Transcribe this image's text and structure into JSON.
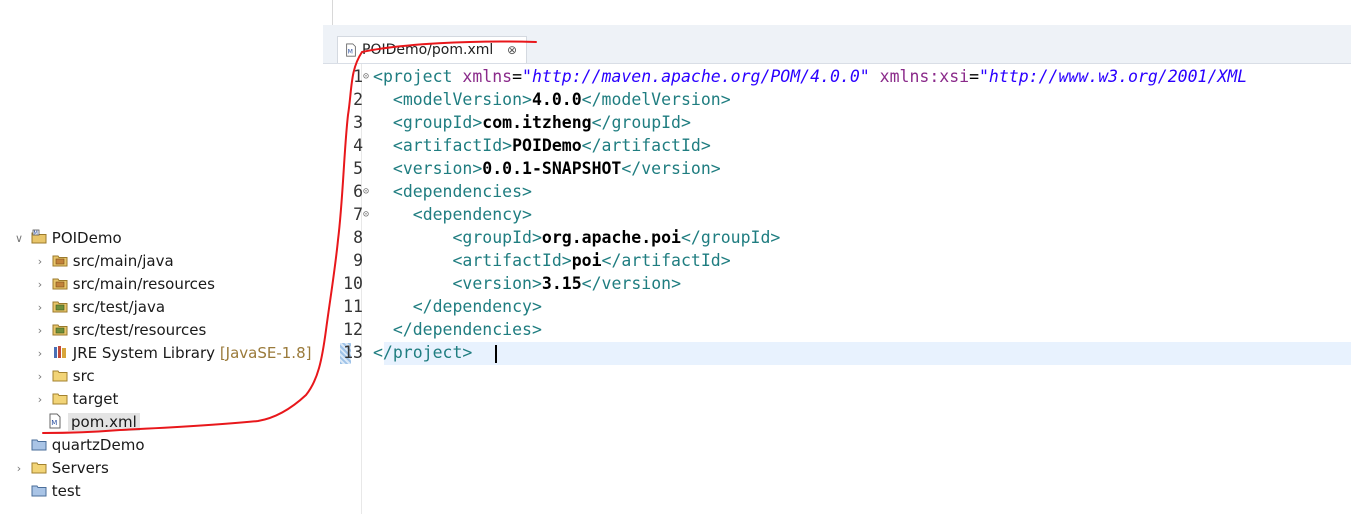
{
  "editor": {
    "tab": {
      "label": "POIDemo/pom.xml",
      "close_glyph": "⊗"
    },
    "lines": [
      {
        "n": "1",
        "fold": "⊝",
        "indent": "",
        "tokens": [
          {
            "t": "bracket",
            "v": "<"
          },
          {
            "t": "tag",
            "v": "project"
          },
          {
            "t": "eq",
            "v": " "
          },
          {
            "t": "attr",
            "v": "xmlns"
          },
          {
            "t": "eq",
            "v": "="
          },
          {
            "t": "str",
            "v": "\"http://maven.apache.org/POM/4.0.0\""
          },
          {
            "t": "eq",
            "v": " "
          },
          {
            "t": "attr",
            "v": "xmlns:xsi"
          },
          {
            "t": "eq",
            "v": "="
          },
          {
            "t": "str",
            "v": "\"http://www.w3.org/2001/XML"
          }
        ]
      },
      {
        "n": "2",
        "fold": "",
        "indent": "  ",
        "tokens": [
          {
            "t": "bracket",
            "v": "<"
          },
          {
            "t": "tag",
            "v": "modelVersion"
          },
          {
            "t": "bracket",
            "v": ">"
          },
          {
            "t": "text",
            "v": "4.0.0"
          },
          {
            "t": "bracket",
            "v": "</"
          },
          {
            "t": "tag",
            "v": "modelVersion"
          },
          {
            "t": "bracket",
            "v": ">"
          }
        ]
      },
      {
        "n": "3",
        "fold": "",
        "indent": "  ",
        "tokens": [
          {
            "t": "bracket",
            "v": "<"
          },
          {
            "t": "tag",
            "v": "groupId"
          },
          {
            "t": "bracket",
            "v": ">"
          },
          {
            "t": "text",
            "v": "com.itzheng"
          },
          {
            "t": "bracket",
            "v": "</"
          },
          {
            "t": "tag",
            "v": "groupId"
          },
          {
            "t": "bracket",
            "v": ">"
          }
        ]
      },
      {
        "n": "4",
        "fold": "",
        "indent": "  ",
        "tokens": [
          {
            "t": "bracket",
            "v": "<"
          },
          {
            "t": "tag",
            "v": "artifactId"
          },
          {
            "t": "bracket",
            "v": ">"
          },
          {
            "t": "text",
            "v": "POIDemo"
          },
          {
            "t": "bracket",
            "v": "</"
          },
          {
            "t": "tag",
            "v": "artifactId"
          },
          {
            "t": "bracket",
            "v": ">"
          }
        ]
      },
      {
        "n": "5",
        "fold": "",
        "indent": "  ",
        "tokens": [
          {
            "t": "bracket",
            "v": "<"
          },
          {
            "t": "tag",
            "v": "version"
          },
          {
            "t": "bracket",
            "v": ">"
          },
          {
            "t": "text",
            "v": "0.0.1-SNAPSHOT"
          },
          {
            "t": "bracket",
            "v": "</"
          },
          {
            "t": "tag",
            "v": "version"
          },
          {
            "t": "bracket",
            "v": ">"
          }
        ]
      },
      {
        "n": "6",
        "fold": "⊝",
        "indent": "  ",
        "tokens": [
          {
            "t": "bracket",
            "v": "<"
          },
          {
            "t": "tag",
            "v": "dependencies"
          },
          {
            "t": "bracket",
            "v": ">"
          }
        ]
      },
      {
        "n": "7",
        "fold": "⊝",
        "indent": "    ",
        "tokens": [
          {
            "t": "bracket",
            "v": "<"
          },
          {
            "t": "tag",
            "v": "dependency"
          },
          {
            "t": "bracket",
            "v": ">"
          }
        ]
      },
      {
        "n": "8",
        "fold": "",
        "indent": "        ",
        "tokens": [
          {
            "t": "bracket",
            "v": "<"
          },
          {
            "t": "tag",
            "v": "groupId"
          },
          {
            "t": "bracket",
            "v": ">"
          },
          {
            "t": "text",
            "v": "org.apache.poi"
          },
          {
            "t": "bracket",
            "v": "</"
          },
          {
            "t": "tag",
            "v": "groupId"
          },
          {
            "t": "bracket",
            "v": ">"
          }
        ]
      },
      {
        "n": "9",
        "fold": "",
        "indent": "        ",
        "tokens": [
          {
            "t": "bracket",
            "v": "<"
          },
          {
            "t": "tag",
            "v": "artifactId"
          },
          {
            "t": "bracket",
            "v": ">"
          },
          {
            "t": "text",
            "v": "poi"
          },
          {
            "t": "bracket",
            "v": "</"
          },
          {
            "t": "tag",
            "v": "artifactId"
          },
          {
            "t": "bracket",
            "v": ">"
          }
        ]
      },
      {
        "n": "10",
        "fold": "",
        "indent": "        ",
        "tokens": [
          {
            "t": "bracket",
            "v": "<"
          },
          {
            "t": "tag",
            "v": "version"
          },
          {
            "t": "bracket",
            "v": ">"
          },
          {
            "t": "text",
            "v": "3.15"
          },
          {
            "t": "bracket",
            "v": "</"
          },
          {
            "t": "tag",
            "v": "version"
          },
          {
            "t": "bracket",
            "v": ">"
          }
        ]
      },
      {
        "n": "11",
        "fold": "",
        "indent": "    ",
        "tokens": [
          {
            "t": "bracket",
            "v": "</"
          },
          {
            "t": "tag",
            "v": "dependency"
          },
          {
            "t": "bracket",
            "v": ">"
          }
        ]
      },
      {
        "n": "12",
        "fold": "",
        "indent": "  ",
        "tokens": [
          {
            "t": "bracket",
            "v": "</"
          },
          {
            "t": "tag",
            "v": "dependencies"
          },
          {
            "t": "bracket",
            "v": ">"
          }
        ]
      },
      {
        "n": "13",
        "fold": "",
        "indent": "",
        "tokens": [
          {
            "t": "bracket",
            "v": "</"
          },
          {
            "t": "tag",
            "v": "project"
          },
          {
            "t": "bracket",
            "v": ">"
          }
        ]
      }
    ]
  },
  "explorer": {
    "items": [
      {
        "label": "POIDemo",
        "decor": "",
        "arrow": "∨",
        "icon": "maven-project-icon",
        "selected": false
      },
      {
        "label": "src/main/java",
        "decor": "",
        "arrow": "›",
        "icon": "source-folder-icon",
        "selected": false
      },
      {
        "label": "src/main/resources",
        "decor": "",
        "arrow": "›",
        "icon": "source-folder-icon",
        "selected": false
      },
      {
        "label": "src/test/java",
        "decor": "",
        "arrow": "›",
        "icon": "test-source-folder-icon",
        "selected": false
      },
      {
        "label": "src/test/resources",
        "decor": "",
        "arrow": "›",
        "icon": "test-source-folder-icon",
        "selected": false
      },
      {
        "label": "JRE System Library",
        "decor": "[JavaSE-1.8]",
        "arrow": "›",
        "icon": "library-icon",
        "selected": false
      },
      {
        "label": "src",
        "decor": "",
        "arrow": "›",
        "icon": "folder-icon",
        "selected": false
      },
      {
        "label": "target",
        "decor": "",
        "arrow": "›",
        "icon": "folder-icon",
        "selected": false
      },
      {
        "label": "pom.xml",
        "decor": "",
        "arrow": "",
        "icon": "maven-file-icon",
        "selected": true
      },
      {
        "label": "quartzDemo",
        "decor": "",
        "arrow": "",
        "icon": "closed-project-icon",
        "selected": false
      },
      {
        "label": "Servers",
        "decor": "",
        "arrow": "›",
        "icon": "folder-icon",
        "selected": false
      },
      {
        "label": "test",
        "decor": "",
        "arrow": "",
        "icon": "closed-project-icon",
        "selected": false
      }
    ]
  },
  "colors": {
    "tag": "#1f7d80",
    "attribute": "#8a2a8a",
    "string": "#2a00ff",
    "annotation": "#e8171b"
  }
}
